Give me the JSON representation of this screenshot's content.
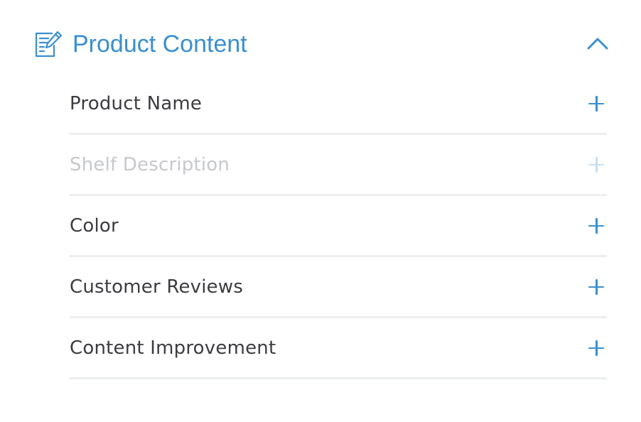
{
  "section": {
    "title": "Product Content",
    "header_icon": "edit-document-icon",
    "toggle_icon": "chevron-up-icon",
    "expanded": true,
    "accent_color": "#3a8fd0"
  },
  "items": [
    {
      "label": "Product Name",
      "icon": "plus-icon",
      "enabled": true
    },
    {
      "label": "Shelf Description",
      "icon": "plus-icon",
      "enabled": false
    },
    {
      "label": "Color",
      "icon": "plus-icon",
      "enabled": true
    },
    {
      "label": "Customer Reviews",
      "icon": "plus-icon",
      "enabled": true
    },
    {
      "label": "Content Improvement",
      "icon": "plus-icon",
      "enabled": true
    }
  ]
}
